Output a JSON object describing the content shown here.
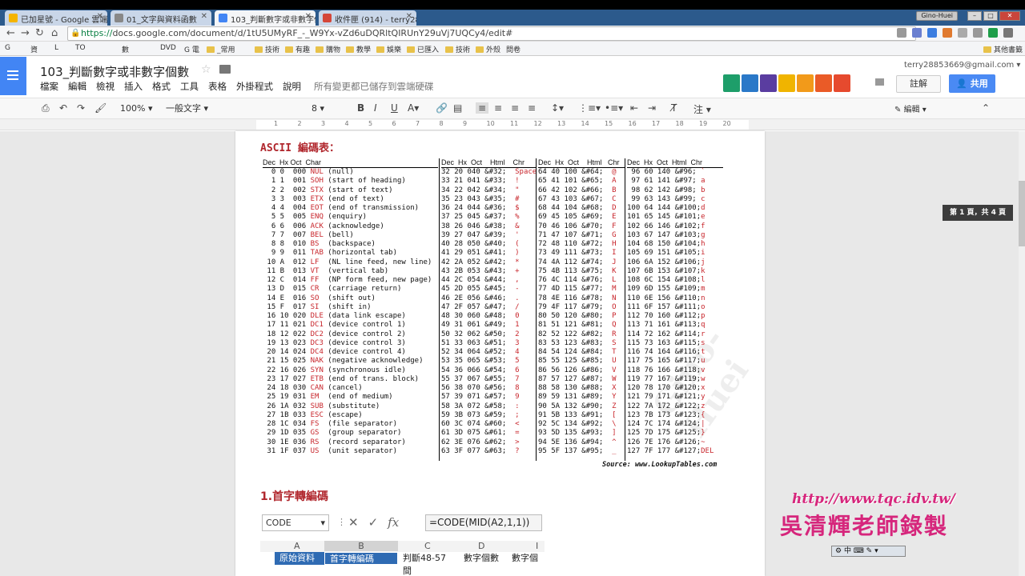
{
  "browser": {
    "tabs": [
      {
        "label": "已加星號 - Google 雲端硬"
      },
      {
        "label": "01_文字與資料函數"
      },
      {
        "label": "103_判斷數字或非數字個"
      },
      {
        "label": "收件匣 (914) - terry2885"
      }
    ],
    "profile_chip": "Gino-Huei",
    "url_scheme": "https://",
    "url_rest": "docs.google.com/document/d/1tU5UMyRF_-_W9Yx-vZd6uDQRltQIRUnY29uVj7UQCy4/edit#",
    "bookmarks": [
      "G",
      "資",
      "L",
      "TO",
      "數",
      "DVD",
      "G 電",
      "_常用",
      "技術",
      "有趣",
      "購物",
      "教學",
      "娛樂",
      "已匯入",
      "技術",
      "外殼",
      "問卷"
    ],
    "other_bookmarks": "其他書籤"
  },
  "docs": {
    "title": "103_判斷數字或非數字個數",
    "menu": [
      "檔案",
      "編輯",
      "檢視",
      "插入",
      "格式",
      "工具",
      "表格",
      "外掛程式",
      "說明"
    ],
    "saved_status": "所有變更都已儲存到雲端硬碟",
    "account": "terry28853669@gmail.com",
    "comments_label": "註解",
    "share_label": "共用",
    "zoom": "100%",
    "style": "一般文字",
    "font_size": "8",
    "mode": "編輯",
    "ruler_numbers": [
      "1",
      "2",
      "3",
      "4",
      "5",
      "6",
      "7",
      "8",
      "9",
      "10",
      "11",
      "12",
      "13",
      "14",
      "15",
      "16",
      "17",
      "18",
      "19",
      "20"
    ]
  },
  "content": {
    "ascii_title": "ASCII  編碼表：",
    "col_headers": [
      "Dec  Hx Oct  Char",
      "Dec  Hx  Oct    Html    Chr",
      "Dec  Hx  Oct    Html   Chr",
      "Dec  Hx  Oct  Html  Chr"
    ],
    "col1": [
      [
        "  0",
        "0",
        "000",
        "NUL",
        "(null)"
      ],
      [
        "  1",
        "1",
        "001",
        "SOH",
        "(start of heading)"
      ],
      [
        "  2",
        "2",
        "002",
        "STX",
        "(start of text)"
      ],
      [
        "  3",
        "3",
        "003",
        "ETX",
        "(end of text)"
      ],
      [
        "  4",
        "4",
        "004",
        "EOT",
        "(end of transmission)"
      ],
      [
        "  5",
        "5",
        "005",
        "ENQ",
        "(enquiry)"
      ],
      [
        "  6",
        "6",
        "006",
        "ACK",
        "(acknowledge)"
      ],
      [
        "  7",
        "7",
        "007",
        "BEL",
        "(bell)"
      ],
      [
        "  8",
        "8",
        "010",
        "BS",
        "(backspace)"
      ],
      [
        "  9",
        "9",
        "011",
        "TAB",
        "(horizontal tab)"
      ],
      [
        " 10",
        "A",
        "012",
        "LF",
        "(NL line feed, new line)"
      ],
      [
        " 11",
        "B",
        "013",
        "VT",
        "(vertical tab)"
      ],
      [
        " 12",
        "C",
        "014",
        "FF",
        "(NP form feed, new page)"
      ],
      [
        " 13",
        "D",
        "015",
        "CR",
        "(carriage return)"
      ],
      [
        " 14",
        "E",
        "016",
        "SO",
        "(shift out)"
      ],
      [
        " 15",
        "F",
        "017",
        "SI",
        "(shift in)"
      ],
      [
        " 16",
        "10",
        "020",
        "DLE",
        "(data link escape)"
      ],
      [
        " 17",
        "11",
        "021",
        "DC1",
        "(device control 1)"
      ],
      [
        " 18",
        "12",
        "022",
        "DC2",
        "(device control 2)"
      ],
      [
        " 19",
        "13",
        "023",
        "DC3",
        "(device control 3)"
      ],
      [
        " 20",
        "14",
        "024",
        "DC4",
        "(device control 4)"
      ],
      [
        " 21",
        "15",
        "025",
        "NAK",
        "(negative acknowledge)"
      ],
      [
        " 22",
        "16",
        "026",
        "SYN",
        "(synchronous idle)"
      ],
      [
        " 23",
        "17",
        "027",
        "ETB",
        "(end of trans. block)"
      ],
      [
        " 24",
        "18",
        "030",
        "CAN",
        "(cancel)"
      ],
      [
        " 25",
        "19",
        "031",
        "EM",
        "(end of medium)"
      ],
      [
        " 26",
        "1A",
        "032",
        "SUB",
        "(substitute)"
      ],
      [
        " 27",
        "1B",
        "033",
        "ESC",
        "(escape)"
      ],
      [
        " 28",
        "1C",
        "034",
        "FS",
        "(file separator)"
      ],
      [
        " 29",
        "1D",
        "035",
        "GS",
        "(group separator)"
      ],
      [
        " 30",
        "1E",
        "036",
        "RS",
        "(record separator)"
      ],
      [
        " 31",
        "1F",
        "037",
        "US",
        "(unit separator)"
      ]
    ],
    "col2": [
      [
        "32 20 040 &#32;",
        "Space"
      ],
      [
        "33 21 041 &#33;",
        "!"
      ],
      [
        "34 22 042 &#34;",
        "\""
      ],
      [
        "35 23 043 &#35;",
        "#"
      ],
      [
        "36 24 044 &#36;",
        "$"
      ],
      [
        "37 25 045 &#37;",
        "%"
      ],
      [
        "38 26 046 &#38;",
        "&"
      ],
      [
        "39 27 047 &#39;",
        "'"
      ],
      [
        "40 28 050 &#40;",
        "("
      ],
      [
        "41 29 051 &#41;",
        ")"
      ],
      [
        "42 2A 052 &#42;",
        "*"
      ],
      [
        "43 2B 053 &#43;",
        "+"
      ],
      [
        "44 2C 054 &#44;",
        ","
      ],
      [
        "45 2D 055 &#45;",
        "-"
      ],
      [
        "46 2E 056 &#46;",
        "."
      ],
      [
        "47 2F 057 &#47;",
        "/"
      ],
      [
        "48 30 060 &#48;",
        "0"
      ],
      [
        "49 31 061 &#49;",
        "1"
      ],
      [
        "50 32 062 &#50;",
        "2"
      ],
      [
        "51 33 063 &#51;",
        "3"
      ],
      [
        "52 34 064 &#52;",
        "4"
      ],
      [
        "53 35 065 &#53;",
        "5"
      ],
      [
        "54 36 066 &#54;",
        "6"
      ],
      [
        "55 37 067 &#55;",
        "7"
      ],
      [
        "56 38 070 &#56;",
        "8"
      ],
      [
        "57 39 071 &#57;",
        "9"
      ],
      [
        "58 3A 072 &#58;",
        ":"
      ],
      [
        "59 3B 073 &#59;",
        ";"
      ],
      [
        "60 3C 074 &#60;",
        "<"
      ],
      [
        "61 3D 075 &#61;",
        "="
      ],
      [
        "62 3E 076 &#62;",
        ">"
      ],
      [
        "63 3F 077 &#63;",
        "?"
      ]
    ],
    "col3": [
      [
        "64 40 100 &#64;",
        "@"
      ],
      [
        "65 41 101 &#65;",
        "A"
      ],
      [
        "66 42 102 &#66;",
        "B"
      ],
      [
        "67 43 103 &#67;",
        "C"
      ],
      [
        "68 44 104 &#68;",
        "D"
      ],
      [
        "69 45 105 &#69;",
        "E"
      ],
      [
        "70 46 106 &#70;",
        "F"
      ],
      [
        "71 47 107 &#71;",
        "G"
      ],
      [
        "72 48 110 &#72;",
        "H"
      ],
      [
        "73 49 111 &#73;",
        "I"
      ],
      [
        "74 4A 112 &#74;",
        "J"
      ],
      [
        "75 4B 113 &#75;",
        "K"
      ],
      [
        "76 4C 114 &#76;",
        "L"
      ],
      [
        "77 4D 115 &#77;",
        "M"
      ],
      [
        "78 4E 116 &#78;",
        "N"
      ],
      [
        "79 4F 117 &#79;",
        "O"
      ],
      [
        "80 50 120 &#80;",
        "P"
      ],
      [
        "81 51 121 &#81;",
        "Q"
      ],
      [
        "82 52 122 &#82;",
        "R"
      ],
      [
        "83 53 123 &#83;",
        "S"
      ],
      [
        "84 54 124 &#84;",
        "T"
      ],
      [
        "85 55 125 &#85;",
        "U"
      ],
      [
        "86 56 126 &#86;",
        "V"
      ],
      [
        "87 57 127 &#87;",
        "W"
      ],
      [
        "88 58 130 &#88;",
        "X"
      ],
      [
        "89 59 131 &#89;",
        "Y"
      ],
      [
        "90 5A 132 &#90;",
        "Z"
      ],
      [
        "91 5B 133 &#91;",
        "["
      ],
      [
        "92 5C 134 &#92;",
        "\\"
      ],
      [
        "93 5D 135 &#93;",
        "]"
      ],
      [
        "94 5E 136 &#94;",
        "^"
      ],
      [
        "95 5F 137 &#95;",
        "_"
      ]
    ],
    "col4": [
      [
        " 96 60 140 &#96;",
        "`"
      ],
      [
        " 97 61 141 &#97;",
        "a"
      ],
      [
        " 98 62 142 &#98;",
        "b"
      ],
      [
        " 99 63 143 &#99;",
        "c"
      ],
      [
        "100 64 144 &#100;",
        "d"
      ],
      [
        "101 65 145 &#101;",
        "e"
      ],
      [
        "102 66 146 &#102;",
        "f"
      ],
      [
        "103 67 147 &#103;",
        "g"
      ],
      [
        "104 68 150 &#104;",
        "h"
      ],
      [
        "105 69 151 &#105;",
        "i"
      ],
      [
        "106 6A 152 &#106;",
        "j"
      ],
      [
        "107 6B 153 &#107;",
        "k"
      ],
      [
        "108 6C 154 &#108;",
        "l"
      ],
      [
        "109 6D 155 &#109;",
        "m"
      ],
      [
        "110 6E 156 &#110;",
        "n"
      ],
      [
        "111 6F 157 &#111;",
        "o"
      ],
      [
        "112 70 160 &#112;",
        "p"
      ],
      [
        "113 71 161 &#113;",
        "q"
      ],
      [
        "114 72 162 &#114;",
        "r"
      ],
      [
        "115 73 163 &#115;",
        "s"
      ],
      [
        "116 74 164 &#116;",
        "t"
      ],
      [
        "117 75 165 &#117;",
        "u"
      ],
      [
        "118 76 166 &#118;",
        "v"
      ],
      [
        "119 77 167 &#119;",
        "w"
      ],
      [
        "120 78 170 &#120;",
        "x"
      ],
      [
        "121 79 171 &#121;",
        "y"
      ],
      [
        "122 7A 172 &#122;",
        "z"
      ],
      [
        "123 7B 173 &#123;",
        "{"
      ],
      [
        "124 7C 174 &#124;",
        "|"
      ],
      [
        "125 7D 175 &#125;",
        "}"
      ],
      [
        "126 7E 176 &#126;",
        "~"
      ],
      [
        "127 7F 177 &#127;",
        "DEL"
      ]
    ],
    "source": "Source:  www.LookupTables.com",
    "section_heading": "1.首字轉編碼",
    "excel": {
      "name_box": "CODE",
      "formula": "=CODE(MID(A2,1,1))",
      "columns": [
        "A",
        "B",
        "C",
        "D",
        "I"
      ],
      "row_cells": [
        "原始資料",
        "首字轉編碼",
        "判斷48-57間",
        "數字個數",
        "數字個"
      ]
    }
  },
  "overlays": {
    "page_indicator": "第 1 頁，共 4 頁",
    "watermark_url": "http://www.tqc.idv.tw/",
    "watermark_name": "吳清輝老師錄製",
    "ime_text": "中",
    "diagonal_watermark": "Gino-Huei"
  },
  "colors": {
    "docs_blue": "#4285f4",
    "share_blue": "#4a8af4",
    "ascii_red": "#c8262c",
    "watermark_pink": "#d6267c"
  }
}
